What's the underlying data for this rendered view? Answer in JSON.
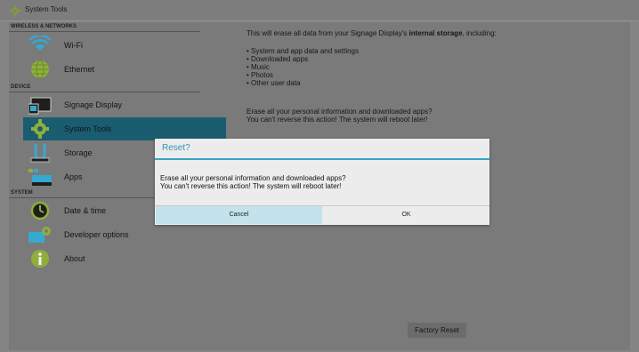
{
  "titlebar": {
    "title": "System Tools",
    "icon": "gear-icon"
  },
  "sections": {
    "wireless": "WIRELESS & NETWORKS",
    "device": "DEVICE",
    "system": "SYSTEM"
  },
  "nav": {
    "wifi": "Wi-Fi",
    "ethernet": "Ethernet",
    "signage": "Signage Display",
    "system_tools": "System Tools",
    "storage": "Storage",
    "apps": "Apps",
    "datetime": "Date & time",
    "developer": "Developer options",
    "about": "About"
  },
  "content": {
    "intro_prefix": "This will erase all data from your Signage Display's ",
    "intro_bold": "internal storage",
    "intro_suffix": ", including:",
    "bullets": [
      "• System and app data and settings",
      "• Downloaded apps",
      "• Music",
      "• Photos",
      "• Other user data"
    ],
    "warning_line1": "Erase all your personal information and downloaded apps?",
    "warning_line2": "You can't reverse this action! The system will reboot later!",
    "factory_reset": "Factory Reset"
  },
  "dialog": {
    "title": "Reset?",
    "message_line1": "Erase all your personal information and downloaded apps?",
    "message_line2": "You can't reverse this action! The system will reboot later!",
    "cancel": "Cancel",
    "ok": "OK"
  },
  "colors": {
    "accent": "#37a4c6",
    "selected": "#1a5d70",
    "backdrop": "#7a7a7a"
  }
}
